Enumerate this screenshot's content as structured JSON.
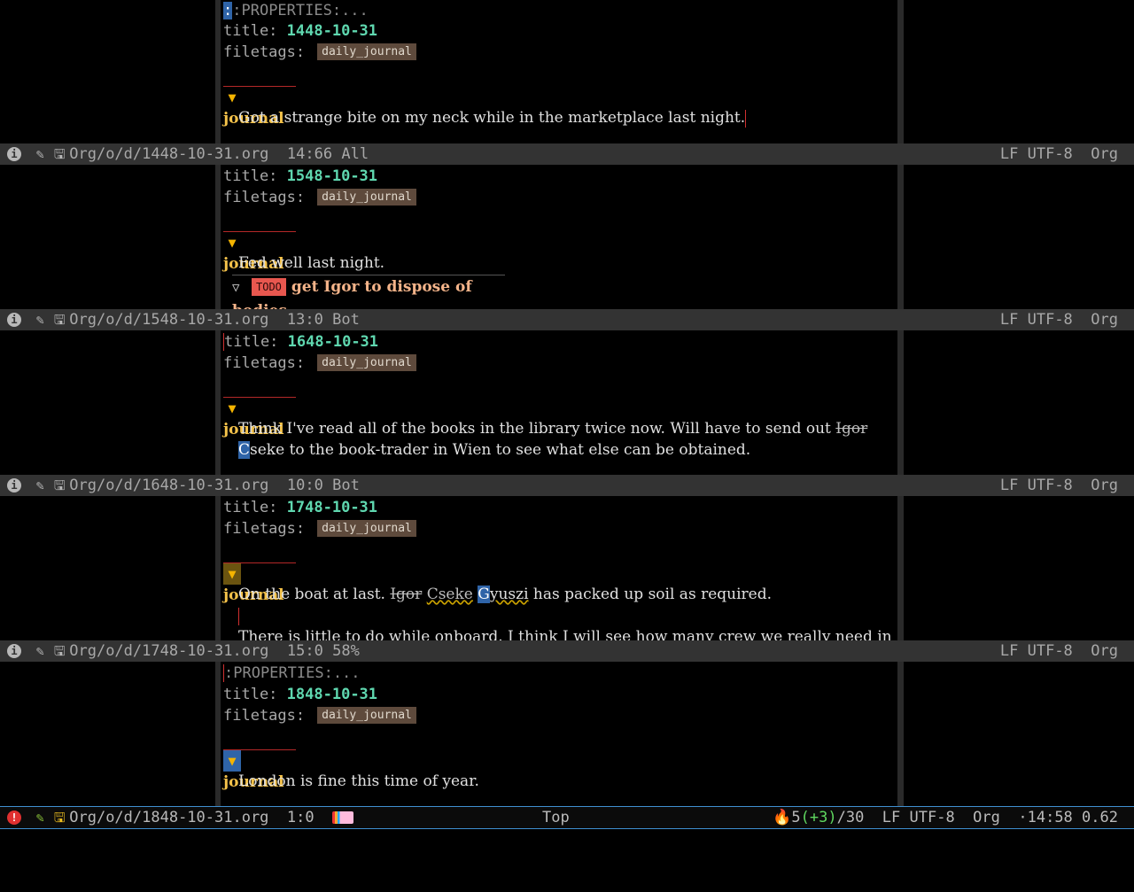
{
  "windows": [
    {
      "top_line": ":PROPERTIES:...",
      "title_key": "title:",
      "title_val": "1448-10-31",
      "filetags_key": "filetags:",
      "tag": "daily_journal",
      "heading": "journal",
      "body": [
        "Got a strange bite on my neck while in the marketplace last night."
      ],
      "modeline": {
        "file": "Org/o/d/1448-10-31.org",
        "pos": "14:66",
        "scroll": "All",
        "encoding": "LF UTF-8",
        "mode": "Org"
      }
    },
    {
      "title_key": "title:",
      "title_val": "1548-10-31",
      "filetags_key": "filetags:",
      "tag": "daily_journal",
      "heading": "journal",
      "body": [
        "Fed well last night."
      ],
      "todo": {
        "keyword": "TODO",
        "text": "get Igor to dispose of bodies"
      },
      "modeline": {
        "file": "Org/o/d/1548-10-31.org",
        "pos": "13:0",
        "scroll": "Bot",
        "encoding": "LF UTF-8",
        "mode": "Org"
      }
    },
    {
      "title_key": "title:",
      "title_val": "1648-10-31",
      "filetags_key": "filetags:",
      "tag": "daily_journal",
      "heading": "journal",
      "body_line1": "Think I've read all of the books in the library twice now. Will have to send out ",
      "body_strike1": "Igor",
      "body_line2_cursor": "C",
      "body_line2": "seke to the book-trader in Wien to see what else can be obtained.",
      "modeline": {
        "file": "Org/o/d/1648-10-31.org",
        "pos": "10:0",
        "scroll": "Bot",
        "encoding": "LF UTF-8",
        "mode": "Org"
      }
    },
    {
      "title_key": "title:",
      "title_val": "1748-10-31",
      "filetags_key": "filetags:",
      "tag": "daily_journal",
      "heading": "journal",
      "body_pre": "On the boat at last. ",
      "body_strike1": "Igor",
      "body_strike2": "Cseke",
      "body_cursor": "G",
      "body_wavy": "yuszi",
      "body_post": " has packed up soil as required.",
      "body_line3": "There is little to do while onboard. I think I will see how many crew we really need in",
      "modeline": {
        "file": "Org/o/d/1748-10-31.org",
        "pos": "15:0",
        "scroll": "58%",
        "encoding": "LF UTF-8",
        "mode": "Org"
      }
    },
    {
      "top_line": ":PROPERTIES:...",
      "title_key": "title:",
      "title_val": "1848-10-31",
      "filetags_key": "filetags:",
      "tag": "daily_journal",
      "heading": "journal",
      "body": [
        "London is fine this time of year."
      ],
      "modeline": {
        "file": "Org/o/d/1848-10-31.org",
        "pos": "1:0",
        "scroll": "Top",
        "flycheck": "5",
        "flycheck_delta": "(+3)",
        "flycheck_total": "/30",
        "encoding": "LF UTF-8",
        "mode": "Org",
        "time": "·14:58",
        "load": "0.62"
      }
    }
  ],
  "icons": {
    "info": "info-icon",
    "edit": "pencil-edit-icon",
    "save": "save-icon",
    "fire": "fire-icon",
    "nyan": "nyan-cat-icon"
  }
}
